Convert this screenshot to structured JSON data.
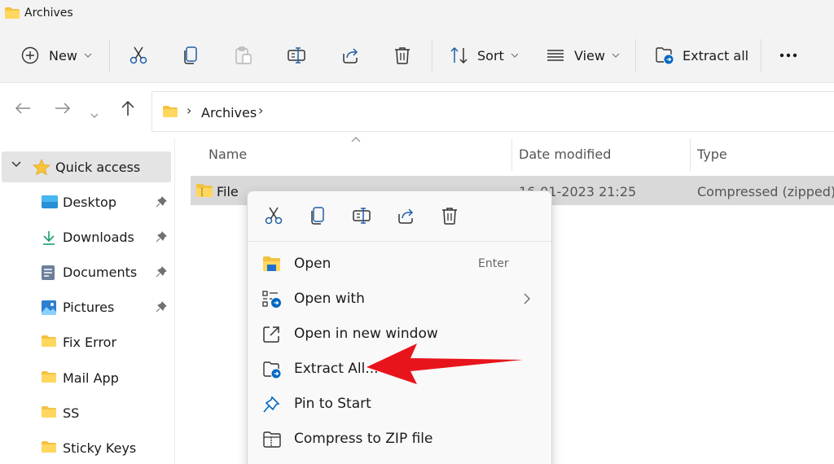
{
  "window": {
    "title": "Archives"
  },
  "toolbar": {
    "new_label": "New",
    "sort_label": "Sort",
    "view_label": "View",
    "extract_all_label": "Extract all"
  },
  "address": {
    "crumb": "Archives"
  },
  "sidebar": {
    "quick_access": "Quick access",
    "items": [
      {
        "label": "Desktop",
        "icon": "desktop-icon",
        "pinned": true
      },
      {
        "label": "Downloads",
        "icon": "download-icon",
        "pinned": true
      },
      {
        "label": "Documents",
        "icon": "documents-icon",
        "pinned": true
      },
      {
        "label": "Pictures",
        "icon": "pictures-icon",
        "pinned": true
      },
      {
        "label": "Fix Error",
        "icon": "folder-icon",
        "pinned": false
      },
      {
        "label": "Mail App",
        "icon": "folder-icon",
        "pinned": false
      },
      {
        "label": "SS",
        "icon": "folder-icon",
        "pinned": false
      },
      {
        "label": "Sticky Keys",
        "icon": "folder-icon",
        "pinned": false
      }
    ]
  },
  "filelist": {
    "columns": {
      "name": "Name",
      "date": "Date modified",
      "type": "Type"
    },
    "rows": [
      {
        "name": "File",
        "date": "16-01-2023 21:25",
        "type": "Compressed (zipped)..."
      }
    ]
  },
  "context_menu": {
    "items": [
      {
        "label": "Open",
        "accel": "Enter"
      },
      {
        "label": "Open with"
      },
      {
        "label": "Open in new window"
      },
      {
        "label": "Extract All..."
      },
      {
        "label": "Pin to Start"
      },
      {
        "label": "Compress to ZIP file"
      }
    ]
  },
  "colors": {
    "folder_yellow": "#f4c241",
    "accent_blue": "#0067c0",
    "arrow_red": "#e8141b"
  }
}
